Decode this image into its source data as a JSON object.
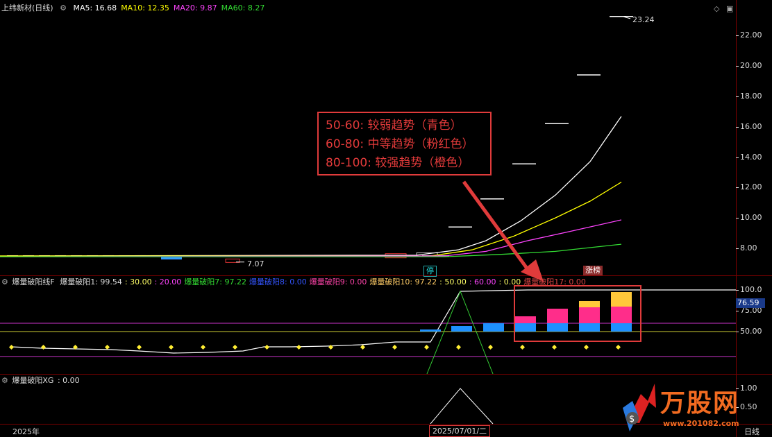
{
  "main": {
    "title": "上纬新材(日线)",
    "ma": [
      {
        "label": "MA5: 16.68",
        "color": "#ffffff"
      },
      {
        "label": "MA10: 12.35",
        "color": "#ffff00"
      },
      {
        "label": "MA20: 9.87",
        "color": "#ff44ff"
      },
      {
        "label": "MA60: 8.27",
        "color": "#33dd33"
      }
    ],
    "yticks": [
      "22.00",
      "20.00",
      "18.00",
      "16.00",
      "14.00",
      "12.00",
      "10.00",
      "8.00"
    ],
    "high_label": "23.24",
    "low_label": "7.07",
    "tag_halt": "停",
    "tag_rank": "涨榜"
  },
  "callout": {
    "lines": [
      "50-60: 较弱趋势（青色）",
      "60-80: 中等趋势（粉红色）",
      "80-100: 较强趋势（橙色）"
    ]
  },
  "ind1": {
    "name": "爆量破阳线F",
    "items": [
      {
        "label": "爆量破阳1: 99.54",
        "color": "#dddddd"
      },
      {
        "label": ": 30.00",
        "color": "#ffff66"
      },
      {
        "label": ": 20.00",
        "color": "#ff44ff"
      },
      {
        "label": "爆量破阳7: 97.22",
        "color": "#33dd33"
      },
      {
        "label": "爆量破阳8: 0.00",
        "color": "#3355ff"
      },
      {
        "label": "爆量破阳9: 0.00",
        "color": "#ff44aa"
      },
      {
        "label": "爆量破阳10: 97.22",
        "color": "#ffcc66"
      },
      {
        "label": ": 50.00",
        "color": "#ffff66"
      },
      {
        "label": ": 60.00",
        "color": "#ff44ff"
      },
      {
        "label": ": 0.00",
        "color": "#ffff66"
      },
      {
        "label": "爆量破阳17: 0.00",
        "color": "#dd4444"
      }
    ],
    "yticks": [
      "100.0",
      "75.00",
      "50.00"
    ],
    "badge": "76.59",
    "bars": [
      {
        "cyan": 3,
        "pink": 0,
        "orange": 0
      },
      {
        "cyan": 8,
        "pink": 0,
        "orange": 0
      },
      {
        "cyan": 12,
        "pink": 0,
        "orange": 0
      },
      {
        "cyan": 12,
        "pink": 10,
        "orange": 0
      },
      {
        "cyan": 12,
        "pink": 21,
        "orange": 0
      },
      {
        "cyan": 12,
        "pink": 23,
        "orange": 9
      },
      {
        "cyan": 12,
        "pink": 24,
        "orange": 21
      }
    ]
  },
  "ind2": {
    "name": "爆量破阳XG",
    "value": ": 0.00",
    "yticks": [
      "1.00",
      "0.50"
    ]
  },
  "footer": {
    "year": "2025年",
    "date": "2025/07/01/二",
    "period": "日线"
  },
  "watermark": {
    "brand": "万股网",
    "url": "www.201082.com"
  }
}
